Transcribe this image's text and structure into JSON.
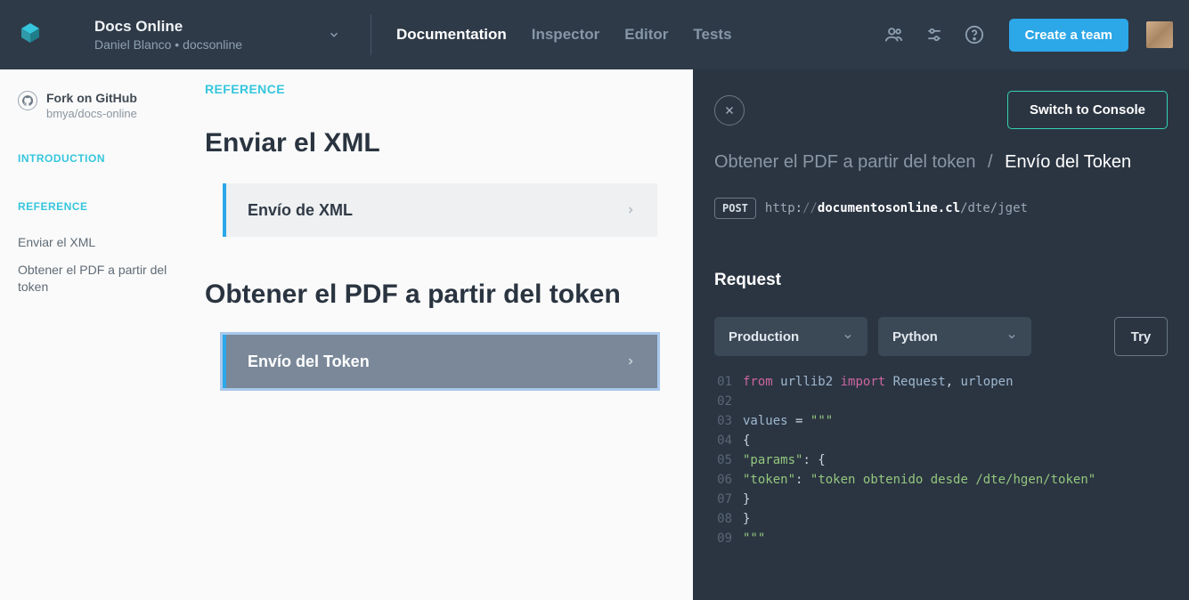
{
  "header": {
    "project_title": "Docs Online",
    "project_author": "Daniel Blanco",
    "project_slug": "docsonline",
    "nav": {
      "documentation": "Documentation",
      "inspector": "Inspector",
      "editor": "Editor",
      "tests": "Tests"
    },
    "cta": "Create a team"
  },
  "sidebar": {
    "github": {
      "title": "Fork on GitHub",
      "repo": "bmya/docs-online"
    },
    "introduction_label": "INTRODUCTION",
    "reference_label": "REFERENCE",
    "items": [
      {
        "label": "Enviar el XML"
      },
      {
        "label": "Obtener el PDF a partir del token"
      }
    ]
  },
  "doc": {
    "reference_label": "REFERENCE",
    "sections": [
      {
        "heading": "Enviar el XML",
        "card": "Envío de XML"
      },
      {
        "heading": "Obtener el PDF a partir del token",
        "card": "Envío del Token"
      }
    ]
  },
  "panel": {
    "switch_label": "Switch to Console",
    "breadcrumb_parent": "Obtener el PDF a partir del token",
    "breadcrumb_current": "Envío del Token",
    "method": "POST",
    "url": {
      "scheme": "http",
      "host": "documentosonline.cl",
      "path": "/dte/jget"
    },
    "request_label": "Request",
    "env_label": "Production",
    "lang_label": "Python",
    "try_label": "Try",
    "code": [
      {
        "n": "01",
        "tokens": [
          [
            "kw",
            "from"
          ],
          [
            "sp",
            " "
          ],
          [
            "id",
            "urllib2"
          ],
          [
            "sp",
            " "
          ],
          [
            "kw",
            "import"
          ],
          [
            "sp",
            " "
          ],
          [
            "id",
            "Request"
          ],
          [
            "op",
            ","
          ],
          [
            "sp",
            " "
          ],
          [
            "id",
            "urlopen"
          ]
        ]
      },
      {
        "n": "02",
        "tokens": []
      },
      {
        "n": "03",
        "tokens": [
          [
            "id",
            "values"
          ],
          [
            "sp",
            " "
          ],
          [
            "op",
            "="
          ],
          [
            "sp",
            " "
          ],
          [
            "str",
            "\"\"\""
          ]
        ]
      },
      {
        "n": "04",
        "tokens": [
          [
            "pl",
            "  {"
          ]
        ]
      },
      {
        "n": "05",
        "tokens": [
          [
            "pl",
            "    "
          ],
          [
            "str",
            "\"params\""
          ],
          [
            "op",
            ":"
          ],
          [
            "pl",
            " {"
          ]
        ]
      },
      {
        "n": "06",
        "tokens": [
          [
            "pl",
            "      "
          ],
          [
            "str",
            "\"token\""
          ],
          [
            "op",
            ":"
          ],
          [
            "pl",
            " "
          ],
          [
            "str",
            "\"token obtenido desde /dte/hgen/token\""
          ]
        ]
      },
      {
        "n": "07",
        "tokens": [
          [
            "pl",
            "    }"
          ]
        ]
      },
      {
        "n": "08",
        "tokens": [
          [
            "pl",
            "  }"
          ]
        ]
      },
      {
        "n": "09",
        "tokens": [
          [
            "str",
            "\"\"\""
          ]
        ]
      }
    ]
  }
}
